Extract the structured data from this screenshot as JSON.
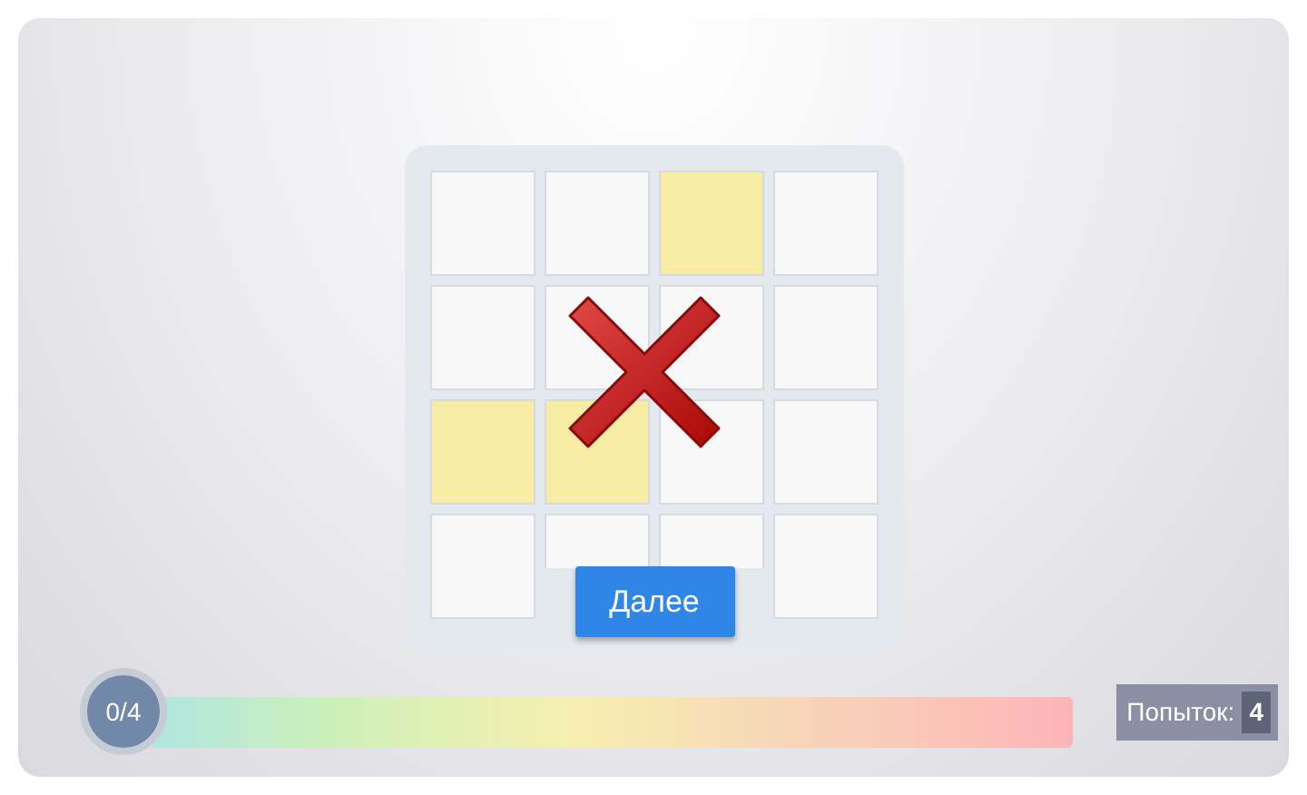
{
  "grid": {
    "rows": [
      [
        {
          "highlighted": false
        },
        {
          "highlighted": false
        },
        {
          "highlighted": true
        },
        {
          "highlighted": false
        }
      ],
      [
        {
          "highlighted": false
        },
        {
          "highlighted": false
        },
        {
          "highlighted": false
        },
        {
          "highlighted": false
        }
      ],
      [
        {
          "highlighted": true
        },
        {
          "highlighted": true
        },
        {
          "highlighted": false
        },
        {
          "highlighted": false
        }
      ],
      [
        {
          "highlighted": false
        },
        {
          "highlighted": false
        },
        {
          "highlighted": false
        },
        {
          "highlighted": false
        }
      ]
    ]
  },
  "result": {
    "kind": "wrong"
  },
  "next_button": "Далее",
  "progress": {
    "label": "0/4"
  },
  "attempts": {
    "label": "Попыток:",
    "value": "4"
  }
}
